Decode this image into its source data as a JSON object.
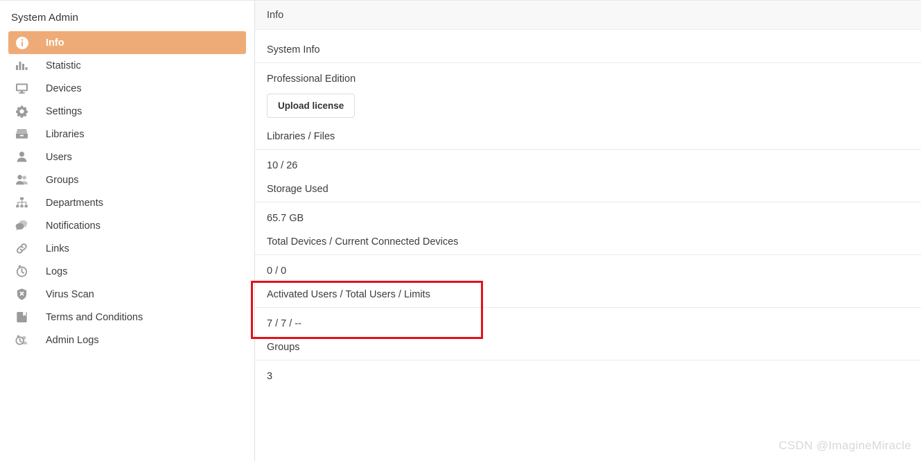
{
  "sidebar": {
    "title": "System Admin",
    "items": [
      {
        "label": "Info",
        "icon": "info-circle-icon",
        "active": true
      },
      {
        "label": "Statistic",
        "icon": "bar-chart-icon",
        "active": false
      },
      {
        "label": "Devices",
        "icon": "monitor-icon",
        "active": false
      },
      {
        "label": "Settings",
        "icon": "gear-icon",
        "active": false
      },
      {
        "label": "Libraries",
        "icon": "file-cabinet-icon",
        "active": false
      },
      {
        "label": "Users",
        "icon": "user-icon",
        "active": false
      },
      {
        "label": "Groups",
        "icon": "users-group-icon",
        "active": false
      },
      {
        "label": "Departments",
        "icon": "org-chart-icon",
        "active": false
      },
      {
        "label": "Notifications",
        "icon": "speech-bubbles-icon",
        "active": false
      },
      {
        "label": "Links",
        "icon": "link-chain-icon",
        "active": false
      },
      {
        "label": "Logs",
        "icon": "history-clock-icon",
        "active": false
      },
      {
        "label": "Virus Scan",
        "icon": "shield-x-icon",
        "active": false
      },
      {
        "label": "Terms and Conditions",
        "icon": "book-icon",
        "active": false
      },
      {
        "label": "Admin Logs",
        "icon": "clock-user-icon",
        "active": false
      }
    ]
  },
  "header": {
    "title": "Info"
  },
  "main": {
    "rows": [
      {
        "label": "System Info",
        "value": "Professional Edition",
        "highlighted": false
      },
      {
        "label": "Libraries / Files",
        "value": "10 / 26",
        "highlighted": false
      },
      {
        "label": "Storage Used",
        "value": "65.7 GB",
        "highlighted": false
      },
      {
        "label": "Total Devices / Current Connected Devices",
        "value": "0 / 0",
        "highlighted": false
      },
      {
        "label": "Activated Users / Total Users / Limits",
        "value": "7 / 7 / --",
        "highlighted": true
      },
      {
        "label": "Groups",
        "value": "3",
        "highlighted": false
      }
    ],
    "upload_license_label": "Upload license"
  },
  "watermark": "CSDN @ImagineMiracle",
  "colors": {
    "accent": "#efab77",
    "highlight_box": "#e1121e",
    "header_bg": "#f8f8f8",
    "divider": "#e9e9e9",
    "text": "#3c3c3c",
    "icon": "#9b9b9b",
    "watermark": "#d8d8d8"
  }
}
